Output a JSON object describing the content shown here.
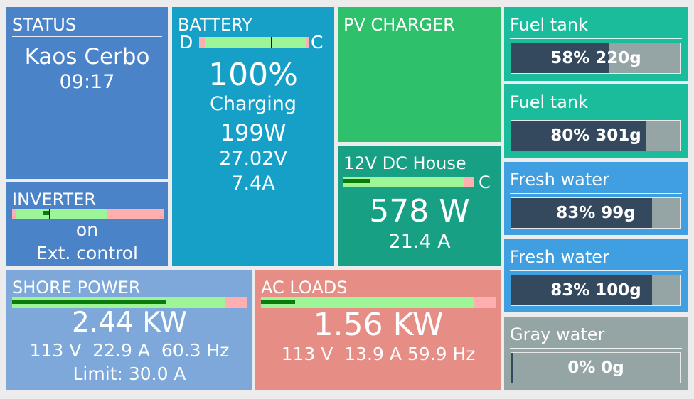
{
  "status": {
    "title": "STATUS",
    "name": "Kaos Cerbo",
    "time": "09:17"
  },
  "inverter": {
    "title": "INVERTER",
    "state": "on",
    "mode": "Ext. control",
    "level": 0.21
  },
  "battery": {
    "title": "BATTERY",
    "discharge_label": "D",
    "charge_label": "C",
    "soc": "100%",
    "state": "Charging",
    "power": "199W",
    "voltage": "27.02V",
    "current": "7.4A",
    "level": 0.67
  },
  "pv_charger": {
    "title": "PV CHARGER"
  },
  "dc_house": {
    "title": "12V DC House",
    "charge_label": "C",
    "power": "578 W",
    "current": "21.4 A",
    "level": 0.23
  },
  "shore_power": {
    "title": "SHORE POWER",
    "power": "2.44 KW",
    "details": "113 V  22.9 A  60.3 Hz",
    "limit": "Limit: 30.0 A",
    "level": 0.7
  },
  "ac_loads": {
    "title": "AC LOADS",
    "power": "1.56 KW",
    "details": "113 V  13.9 A 59.9 Hz",
    "level": 0.15
  },
  "tanks": [
    {
      "title": "Fuel tank",
      "reading": "58% 220g",
      "level": 0.58
    },
    {
      "title": "Fuel tank",
      "reading": "80% 301g",
      "level": 0.8
    },
    {
      "title": "Fresh water",
      "reading": "83% 99g",
      "level": 0.83
    },
    {
      "title": "Fresh water",
      "reading": "83% 100g",
      "level": 0.83
    },
    {
      "title": "Gray water",
      "reading": "0% 0g",
      "level": 0.0
    }
  ],
  "colors": {
    "status": "#4a83c8",
    "inverter": "#4a83c8",
    "battery": "#16a0c8",
    "pv_charger": "#2ec06a",
    "dc_house": "#18a085",
    "shore_power": "#7ea8d9",
    "ac_loads": "#e68e86",
    "fuel_tank": "#1abc9c",
    "fresh_water": "#3f9fe0",
    "gray_water": "#95a5a6",
    "bar_green": "#9df598",
    "bar_dark_green": "#0a7a0a",
    "bar_red": "#ffafaf",
    "tank_fill": "#34495e"
  }
}
